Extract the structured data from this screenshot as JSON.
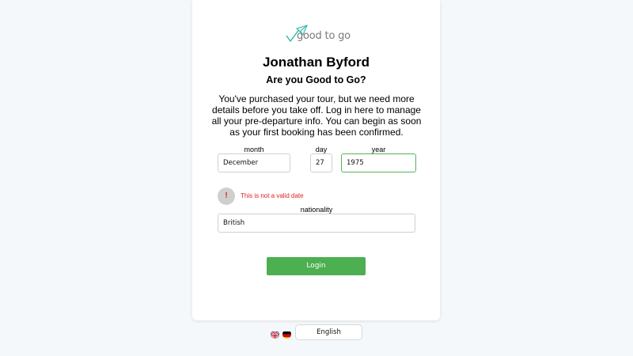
{
  "brand": {
    "logo_text": "good to go",
    "accent_color": "#2bb3a6"
  },
  "user": {
    "name": "Jonathan Byford"
  },
  "subtitle": "Are you Good to Go?",
  "intro": "You've purchased your tour, but we need more details before you take off. Log in here to manage all your pre-departure info. You can begin as soon as your first booking has been confirmed.",
  "form": {
    "month": {
      "label": "month",
      "value": "December"
    },
    "day": {
      "label": "day",
      "value": "27"
    },
    "year": {
      "label": "year",
      "value": "1975"
    },
    "error": {
      "icon": "!",
      "message": "This is not a valid date"
    },
    "nationality": {
      "label": "nationality",
      "value": "British"
    },
    "login_label": "Login"
  },
  "language": {
    "flags": [
      "uk-flag-icon",
      "germany-flag-icon"
    ],
    "selected": "English"
  },
  "colors": {
    "background": "#f5f8fa",
    "button": "#4caf50",
    "error": "#e02020",
    "valid_border": "#56b35a"
  }
}
